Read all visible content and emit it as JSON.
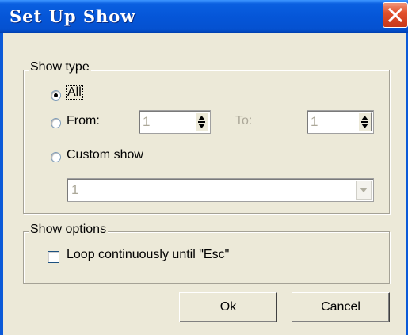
{
  "dialog": {
    "title": "Set Up Show",
    "close_icon": "close-x-icon"
  },
  "show_type": {
    "legend": "Show type",
    "options": {
      "all": {
        "label": "All",
        "selected": true
      },
      "from": {
        "label": "From:",
        "selected": false
      },
      "custom": {
        "label": "Custom show",
        "selected": false
      }
    },
    "from_value": "1",
    "to_label": "To:",
    "to_value": "1",
    "custom_show_value": "1"
  },
  "show_options": {
    "legend": "Show options",
    "loop_label": "Loop continuously until \"Esc\"",
    "loop_checked": false
  },
  "buttons": {
    "ok_label": "Ok",
    "cancel_label": "Cancel"
  },
  "colors": {
    "titlebar": "#0556d8",
    "dialog_bg": "#ece9d8",
    "close_button": "#e2502b",
    "disabled_text": "#aca899"
  }
}
